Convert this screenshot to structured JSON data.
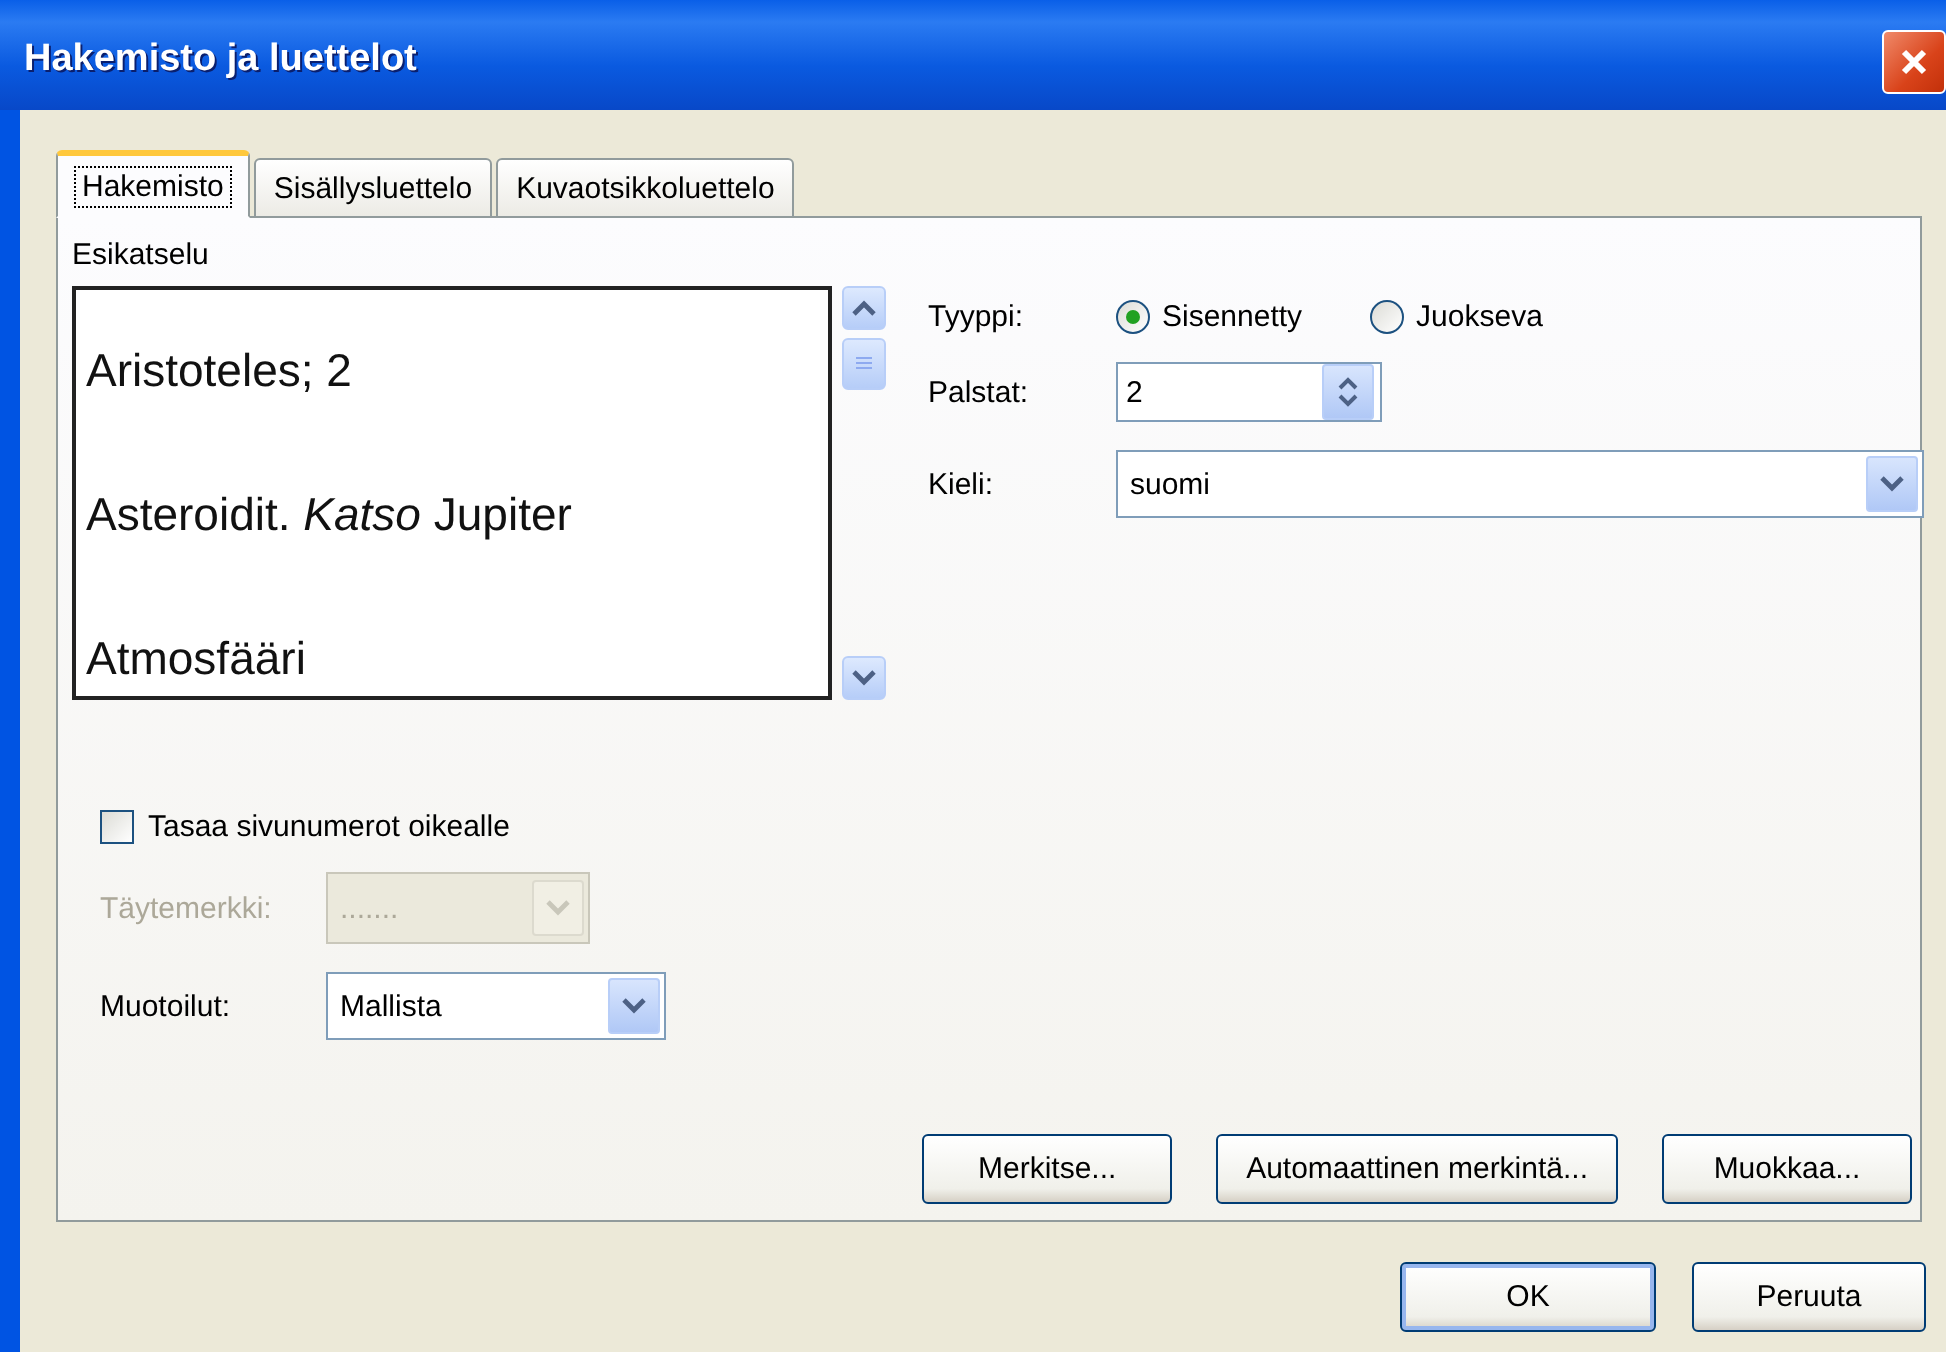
{
  "window": {
    "title": "Hakemisto ja luettelot"
  },
  "tabs": [
    {
      "label": "Hakemisto",
      "selected": true
    },
    {
      "label": "Sisällysluettelo",
      "selected": false
    },
    {
      "label": "Kuvaotsikkoluettelo",
      "selected": false
    }
  ],
  "preview": {
    "label": "Esikatselu",
    "lines": [
      "Aristoteles; 2",
      "Asteroidit. *Katso* Jupiter",
      "Atmosfääri"
    ]
  },
  "type": {
    "label": "Tyyppi:",
    "options": [
      {
        "label": "Sisennetty",
        "selected": true
      },
      {
        "label": "Juokseva",
        "selected": false
      }
    ]
  },
  "columns": {
    "label": "Palstat:",
    "value": "2"
  },
  "language": {
    "label": "Kieli:",
    "value": "suomi"
  },
  "align_page_numbers": {
    "label": "Tasaa sivunumerot oikealle",
    "checked": false
  },
  "tab_leader": {
    "label": "Täytemerkki:",
    "value": ".......",
    "disabled": true
  },
  "formats": {
    "label": "Muotoilut:",
    "value": "Mallista"
  },
  "panel_buttons": [
    "Merkitse...",
    "Automaattinen merkintä...",
    "Muokkaa..."
  ],
  "dialog_buttons": [
    {
      "label": "OK",
      "default": true
    },
    {
      "label": "Peruuta",
      "default": false
    }
  ]
}
